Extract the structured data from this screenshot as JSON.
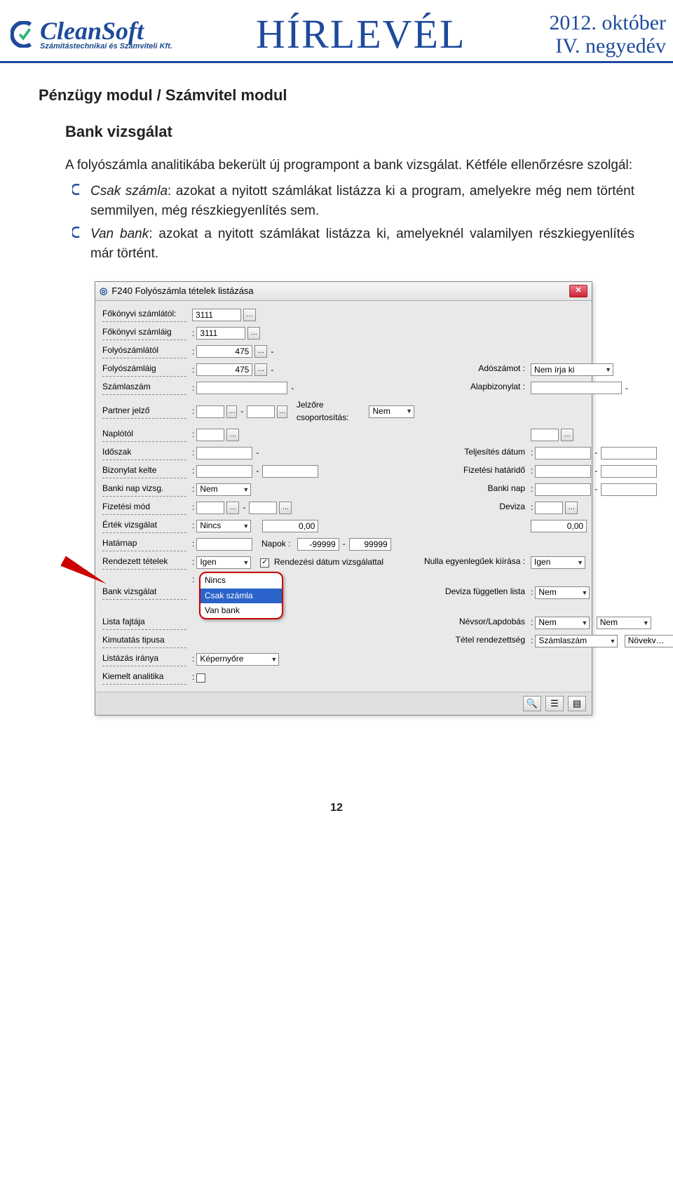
{
  "header": {
    "brand_main": "CleanSoft",
    "brand_sub": "Számítástechnikai és Számviteli Kft.",
    "newsletter": "HÍRLEVÉL",
    "date_line1": "2012. október",
    "date_line2": "IV. negyedév"
  },
  "doc": {
    "section_heading": "Pénzügy modul / Számvitel modul",
    "sub_heading": "Bank vizsgálat",
    "intro": "A folyószámla analitikába bekerült új programpont a bank vizsgálat. Kétféle ellenőrzésre szolgál:",
    "bullets": [
      {
        "lead": "Csak számla",
        "rest": ": azokat a nyitott számlákat listázza ki a program, amelyekre még nem történt semmilyen, még részkiegyenlítés sem."
      },
      {
        "lead": "Van bank",
        "rest": ": azokat a nyitott számlákat listázza ki, amelyeknél valamilyen részkiegyenlítés már történt."
      }
    ],
    "page_number": "12"
  },
  "form": {
    "window_title": "F240 Folyószámla tételek listázása",
    "icon_name": "app-icon",
    "labels": {
      "fokonyvi_szamlatol": "Főkönyvi számlától:",
      "fokonyvi_szamlaig": "Főkönyvi számláig",
      "folyoszamlatol": "Folyószámlától",
      "folyoszamlaig": "Folyószámláig",
      "adoszamot": "Adószámot :",
      "szamlaszam": "Számlaszám",
      "alapbizonylat": "Alapbizonylat :",
      "partner_jelzo": "Partner jelző",
      "jelzore_csoport": "Jelzőre csoportosítás:",
      "naplotol": "Naplótól",
      "idoszak": "Időszak",
      "teljesites_datum": "Teljesítés dátum",
      "bizonylat_kelte": "Bizonylat kelte",
      "fizetesi_hatarido": "Fizetési határidő",
      "banki_nap_vizsg": "Banki nap vizsg.",
      "banki_nap": "Banki nap",
      "fizetesi_mod": "Fizetési mód",
      "deviza": "Deviza",
      "ertek_vizsgalat": "Érték vizsgálat",
      "hatarnap": "Határnap",
      "napok": "Napok :",
      "rendezett_tetelek": "Rendezett tételek",
      "rendezesi_datum": "Rendezési dátum vizsgálattal",
      "nulla_egyenleg": "Nulla egyenlegűek kiírása :",
      "bank_vizsgalat": "Bank vizsgálat",
      "deviza_fuggetlen": "Deviza független lista",
      "lista_fajtaja": "Lista fajtája",
      "nevsor_lapdobas": "Névsor/Lapdobás",
      "kimutatas_tipus": "Kimutatás tipusa",
      "tetel_rendezettseg": "Tétel rendezettség",
      "listazas_iranya": "Listázás iránya",
      "kiemelt_analitika": "Kiemelt analitika"
    },
    "values": {
      "fokonyvi_szamlatol": "3111",
      "fokonyvi_szamlaig": "3111",
      "folyoszamlatol": "475",
      "folyoszamlaig": "475",
      "adoszamot": "Nem írja ki",
      "jelzore_csoport": "Nem",
      "banki_nap_vizsg": "Nem",
      "ertek_vizsgalat": "Nincs",
      "ertek_a": "0,00",
      "ertek_b": "0,00",
      "napok_tol": "-99999",
      "napok_ig": "99999",
      "rendezett_tetelek": "Igen",
      "rendezesi_datum_checked": "✓",
      "nulla_egyenleg": "Igen",
      "bank_vizsgalat": "Nincs",
      "deviza_fuggetlen": "Nem",
      "nevsor_a": "Nem",
      "nevsor_b": "Nem",
      "tetel_rend_a": "Számlaszám",
      "tetel_rend_b": "Növekv…",
      "listazas_iranya": "Képernyőre",
      "dd_opts": {
        "a": "Nincs",
        "b": "Csak számla",
        "c": "Van bank"
      }
    }
  }
}
